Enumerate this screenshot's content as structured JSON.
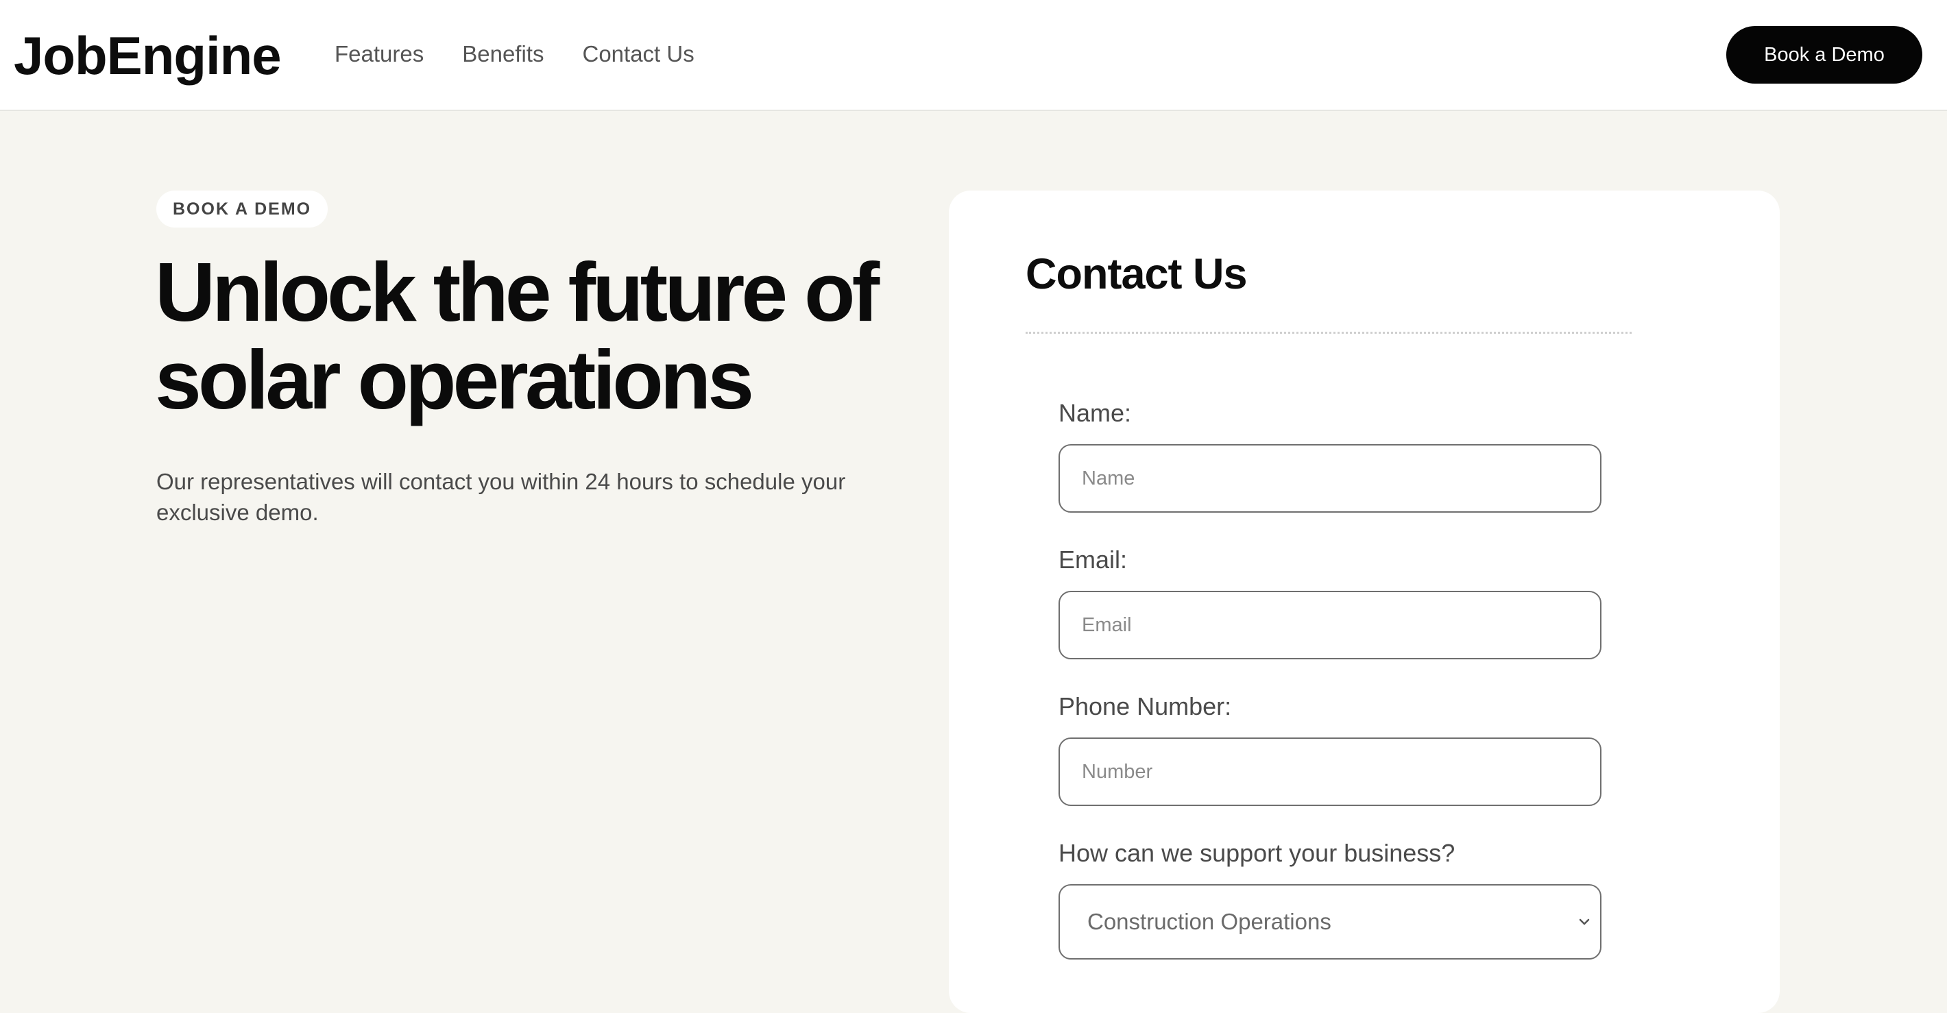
{
  "header": {
    "logo": "JobEngine",
    "nav": [
      "Features",
      "Benefits",
      "Contact Us"
    ],
    "cta_label": "Book a Demo"
  },
  "hero": {
    "eyebrow": "BOOK A DEMO",
    "headline_line1": "Unlock the future of",
    "headline_line2": "solar operations",
    "subtext": "Our representatives will contact you within 24 hours to schedule your exclusive demo."
  },
  "form": {
    "title": "Contact Us",
    "name_label": "Name:",
    "name_placeholder": "Name",
    "email_label": "Email:",
    "email_placeholder": "Email",
    "phone_label": "Phone Number:",
    "phone_placeholder": "Number",
    "support_label": "How can we support your business?",
    "support_value": "Construction Operations"
  },
  "colors": {
    "page_bg": "#f6f5f0",
    "primary": "#050505",
    "card_bg": "#ffffff"
  }
}
